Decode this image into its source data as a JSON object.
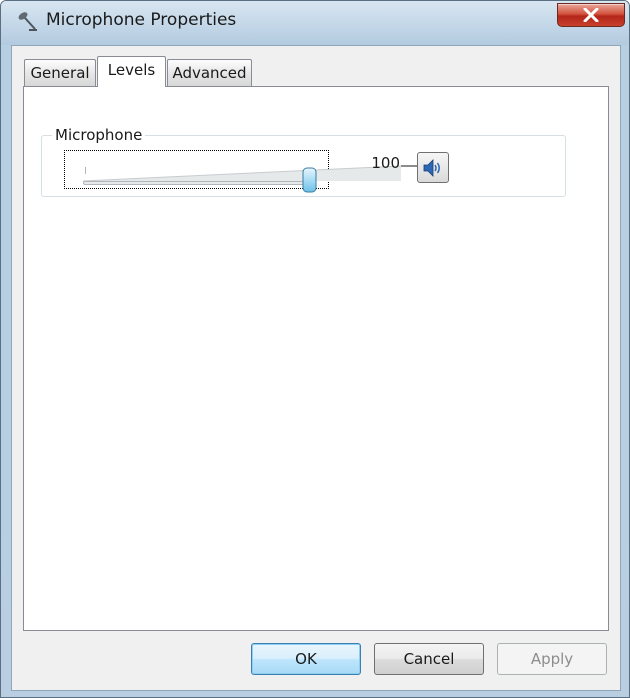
{
  "window": {
    "title": "Microphone Properties"
  },
  "tabs": [
    {
      "label": "General",
      "active": false
    },
    {
      "label": "Levels",
      "active": true
    },
    {
      "label": "Advanced",
      "active": false
    }
  ],
  "levels": {
    "group_label": "Microphone",
    "level_value": "100",
    "level_percent": 100
  },
  "icons": {
    "window_icon": "microphone-icon",
    "close": "close-icon",
    "mute": "speaker-icon"
  },
  "buttons": {
    "ok_label": "OK",
    "cancel_label": "Cancel",
    "apply_label": "Apply"
  },
  "colors": {
    "titlebar": "#c3d7e8",
    "close_button": "#c8412b",
    "default_button": "#bee6fd"
  }
}
